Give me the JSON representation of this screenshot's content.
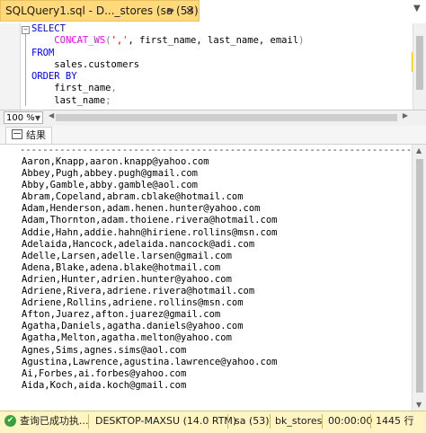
{
  "tab": {
    "title": "SQLQuery1.sql - D..._stores (sa (53))*",
    "pin_icon": "pin-icon",
    "close_icon": "close-icon"
  },
  "editor": {
    "lines": [
      [
        {
          "t": "SELECT",
          "c": "kw"
        }
      ],
      [
        {
          "t": "    ",
          "c": "tx"
        },
        {
          "t": "CONCAT_WS",
          "c": "fn"
        },
        {
          "t": "(",
          "c": "gr"
        },
        {
          "t": "','",
          "c": "str"
        },
        {
          "t": ", first_name, last_name, email",
          "c": "tx"
        },
        {
          "t": ")",
          "c": "gr"
        }
      ],
      [
        {
          "t": "FROM",
          "c": "kw"
        }
      ],
      [
        {
          "t": "    sales.customers",
          "c": "tx"
        }
      ],
      [
        {
          "t": "ORDER BY",
          "c": "kw"
        }
      ],
      [
        {
          "t": "    first_name",
          "c": "tx"
        },
        {
          "t": ",",
          "c": "gr"
        }
      ],
      [
        {
          "t": "    last_name",
          "c": "tx"
        },
        {
          "t": ";",
          "c": "gr"
        }
      ]
    ]
  },
  "zoom": {
    "value": "100 %"
  },
  "results_tab": {
    "label": "结果"
  },
  "results": {
    "separator": "--------------------------------------------------------------------------",
    "rows": [
      "Aaron,Knapp,aaron.knapp@yahoo.com",
      "Abbey,Pugh,abbey.pugh@gmail.com",
      "Abby,Gamble,abby.gamble@aol.com",
      "Abram,Copeland,abram.cblake@hotmail.com",
      "Adam,Henderson,adam.henen.hunter@yahoo.com",
      "Adam,Thornton,adam.thoiene.rivera@hotmail.com",
      "Addie,Hahn,addie.hahn@hiriene.rollins@msn.com",
      "Adelaida,Hancock,adelaida.nancock@adi.com",
      "Adelle,Larsen,adelle.larsen@gmail.com",
      "Adena,Blake,adena.blake@hotmail.com",
      "Adrien,Hunter,adrien.hunter@yahoo.com",
      "Adriene,Rivera,adriene.rivera@hotmail.com",
      "Adriene,Rollins,adriene.rollins@msn.com",
      "Afton,Juarez,afton.juarez@gmail.com",
      "Agatha,Daniels,agatha.daniels@yahoo.com",
      "Agatha,Melton,agatha.melton@yahoo.com",
      "Agnes,Sims,agnes.sims@aol.com",
      "Agustina,Lawrence,agustina.lawrence@yahoo.com",
      "Ai,Forbes,ai.forbes@yahoo.com",
      "Aida,Koch,aida.koch@gmail.com"
    ]
  },
  "status": {
    "message": "查询已成功执...",
    "server": "DESKTOP-MAXSU (14.0 RTM)",
    "user": "sa (53)",
    "database": "bk_stores",
    "elapsed": "00:00:00",
    "rows": "1445 行"
  },
  "colors": {
    "tab_bg": "#ffd97a",
    "status_bg": "#fff5c4",
    "keyword": "#0000ff",
    "function": "#ff00ff",
    "string": "#ff0000"
  }
}
